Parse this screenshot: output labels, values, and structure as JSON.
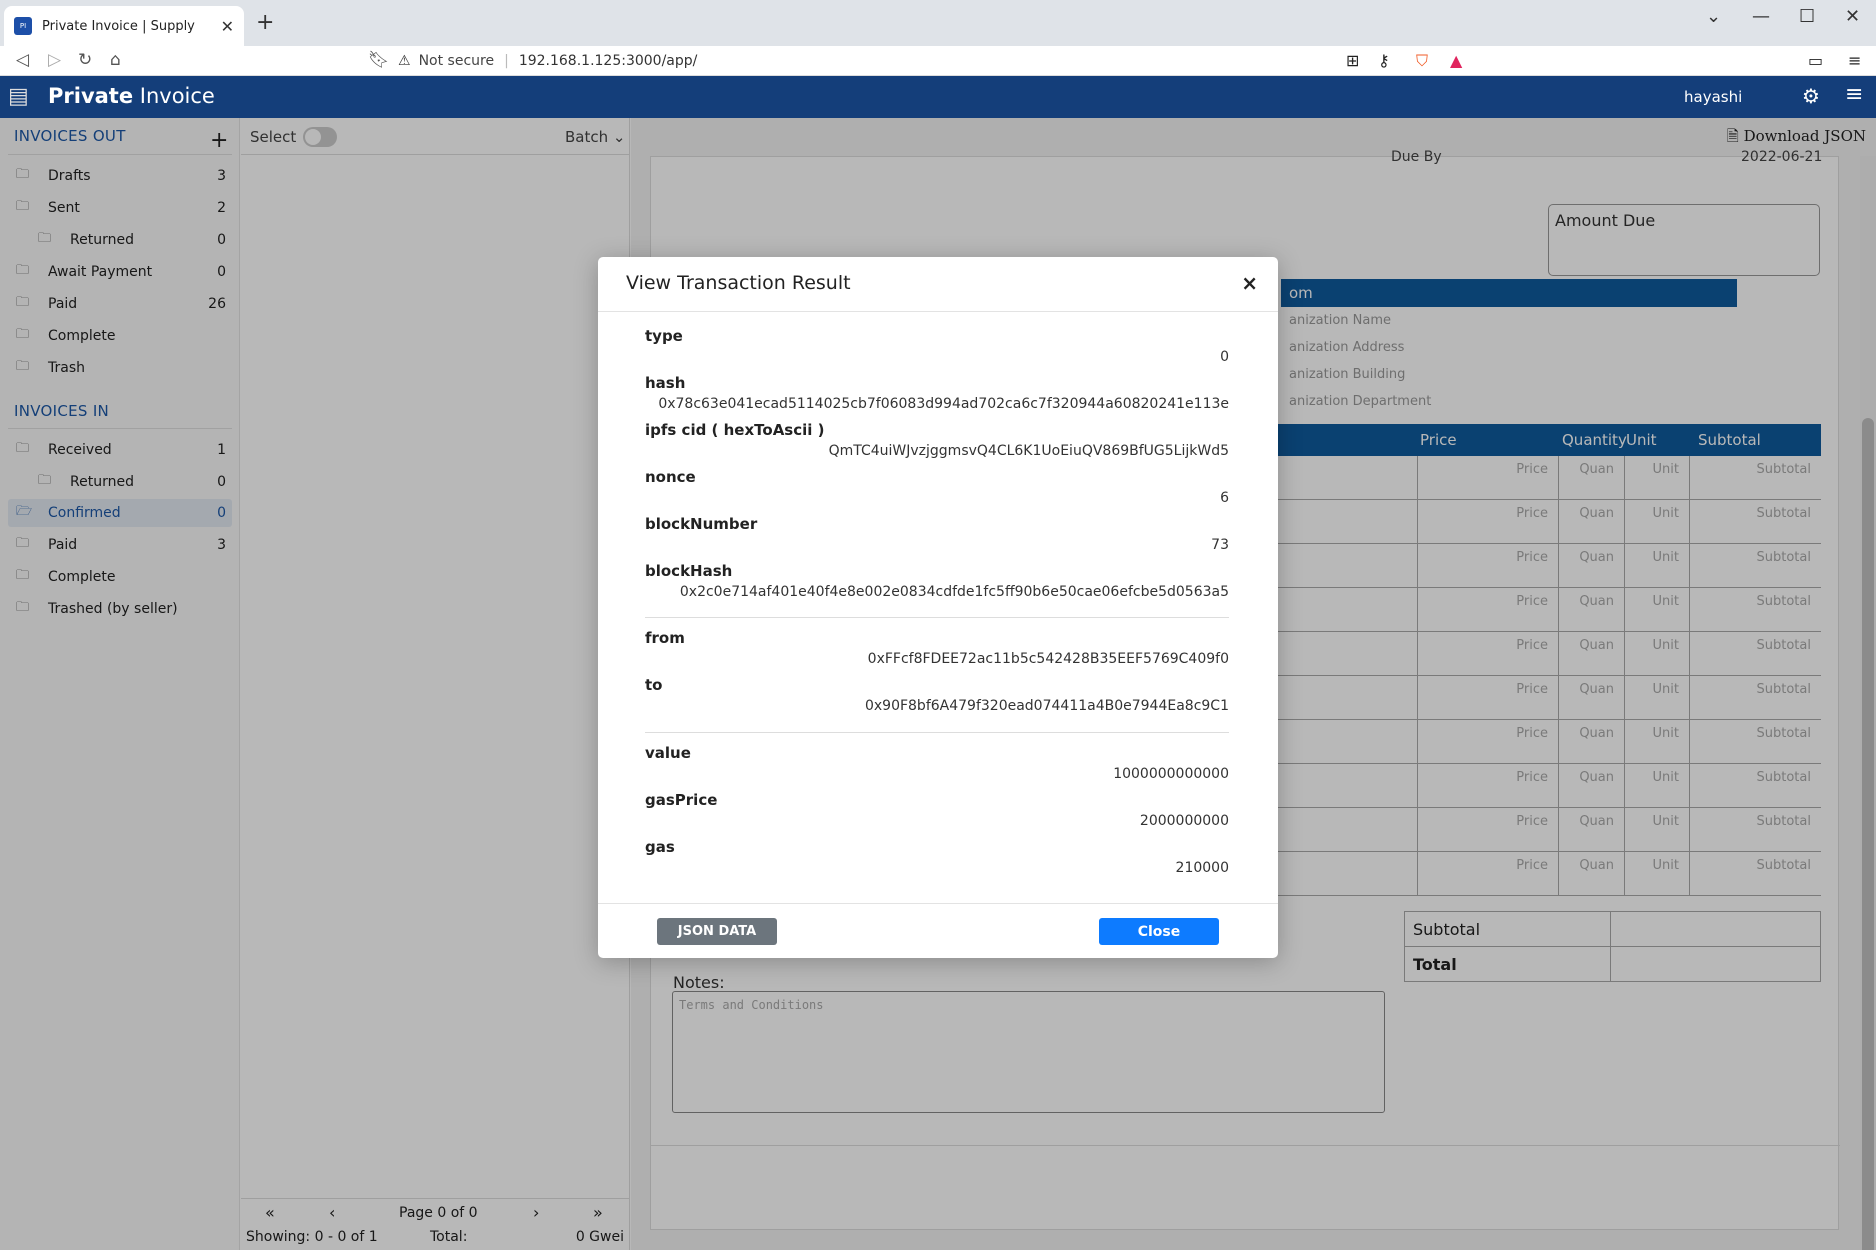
{
  "browser": {
    "tab_title": "Private Invoice | Supply",
    "not_secure": "Not secure",
    "url": "192.168.1.125:3000/app/"
  },
  "app": {
    "logo_bold": "Private",
    "logo_light": " Invoice",
    "user": "hayashi"
  },
  "sidebar": {
    "out_heading": "INVOICES OUT",
    "in_heading": "INVOICES IN",
    "out_items": [
      {
        "label": "Drafts",
        "count": "3"
      },
      {
        "label": "Sent",
        "count": "2"
      },
      {
        "label": "Returned",
        "count": "0"
      },
      {
        "label": "Await Payment",
        "count": "0"
      },
      {
        "label": "Paid",
        "count": "26"
      },
      {
        "label": "Complete",
        "count": ""
      },
      {
        "label": "Trash",
        "count": ""
      }
    ],
    "in_items": [
      {
        "label": "Received",
        "count": "1"
      },
      {
        "label": "Returned",
        "count": "0"
      },
      {
        "label": "Confirmed",
        "count": "0"
      },
      {
        "label": "Paid",
        "count": "3"
      },
      {
        "label": "Complete",
        "count": ""
      },
      {
        "label": "Trashed (by seller)",
        "count": ""
      }
    ]
  },
  "list": {
    "select_label": "Select",
    "batch_label": "Batch",
    "page_label": "Page 0 of 0",
    "showing": "Showing: 0 - 0 of 1",
    "total_label": "Total:",
    "gwei": "0 Gwei"
  },
  "document": {
    "download_json": "Download JSON",
    "due_by_label": "Due By",
    "due_by_value": "2022-06-21",
    "amount_due": "Amount Due",
    "from_bar": "om",
    "org_lines": [
      "anization Name",
      "anization Address",
      "anization Building",
      "anization Department"
    ],
    "columns": {
      "price": "Price",
      "quantity": "Quantity",
      "unit": "Unit",
      "subtotal": "Subtotal"
    },
    "placeholders": {
      "price": "Price",
      "quan": "Quan",
      "unit": "Unit",
      "subtotal": "Subtotal"
    },
    "subtotal_label": "Subtotal",
    "total_label": "Total",
    "notes_label": "Notes:",
    "notes_placeholder": "Terms and Conditions"
  },
  "modal": {
    "title": "View Transaction Result",
    "fields": {
      "type": {
        "key": "type",
        "value": "0"
      },
      "hash": {
        "key": "hash",
        "value": "0x78c63e041ecad5114025cb7f06083d994ad702ca6c7f320944a60820241e113e"
      },
      "ipfs": {
        "key": "ipfs cid ( hexToAscii )",
        "value": "QmTC4uiWJvzjggmsvQ4CL6K1UoEiuQV869BfUG5LijkWd5"
      },
      "nonce": {
        "key": "nonce",
        "value": "6"
      },
      "blockNumber": {
        "key": "blockNumber",
        "value": "73"
      },
      "blockHash": {
        "key": "blockHash",
        "value": "0x2c0e714af401e40f4e8e002e0834cdfde1fc5ff90b6e50cae06efcbe5d0563a5"
      },
      "from": {
        "key": "from",
        "value": "0xFFcf8FDEE72ac11b5c542428B35EEF5769C409f0"
      },
      "to": {
        "key": "to",
        "value": "0x90F8bf6A479f320ead074411a4B0e7944Ea8c9C1"
      },
      "value": {
        "key": "value",
        "value": "1000000000000"
      },
      "gasPrice": {
        "key": "gasPrice",
        "value": "2000000000"
      },
      "gas": {
        "key": "gas",
        "value": "210000"
      }
    },
    "json_button": "JSON DATA",
    "close_button": "Close"
  },
  "colors": {
    "header": "#143e7a",
    "accent": "#0f5a9d",
    "primary_button": "#0d7bff",
    "secondary_button": "#6c757d"
  }
}
